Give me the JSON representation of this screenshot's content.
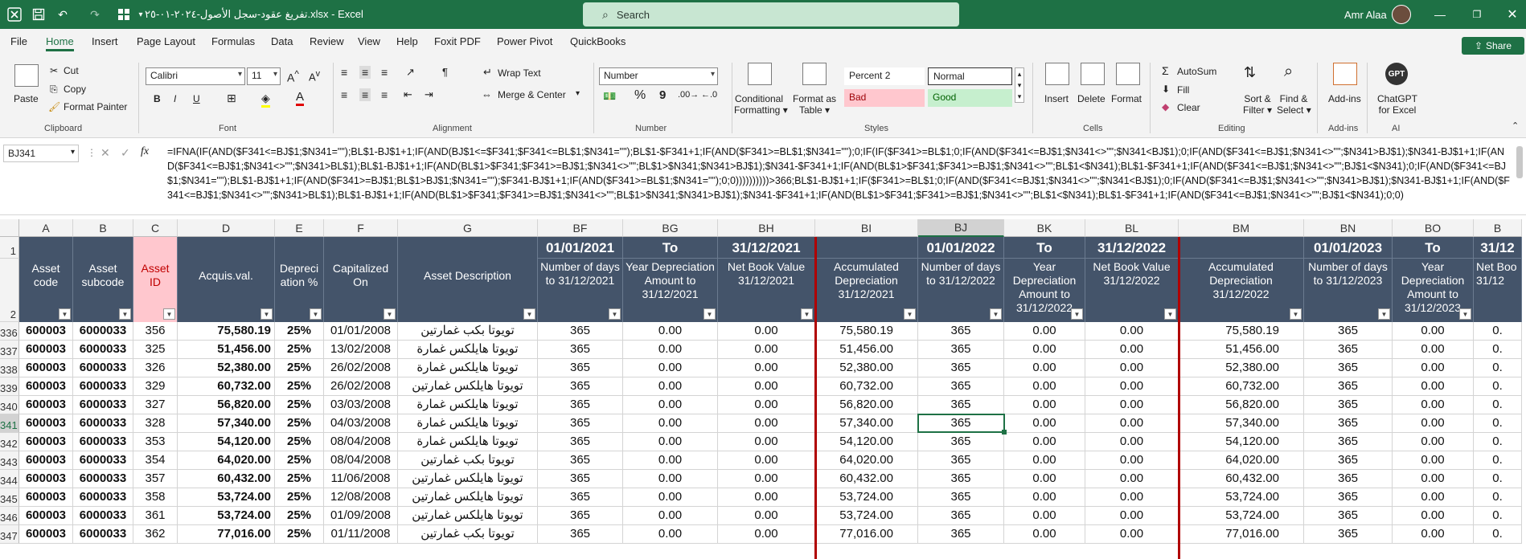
{
  "app": {
    "window_title": "تفريغ عقود-سجل الأصول-٢٠٢٤-٠١-٢٥.xlsx - Excel",
    "search_placeholder": "Search",
    "user_name": "Amr Alaa"
  },
  "menu": [
    "File",
    "Home",
    "Insert",
    "Page Layout",
    "Formulas",
    "Data",
    "Review",
    "View",
    "Help",
    "Foxit PDF",
    "Power Pivot",
    "QuickBooks"
  ],
  "share_label": "Share",
  "ribbon": {
    "clipboard": {
      "paste": "Paste",
      "cut": "Cut",
      "copy": "Copy",
      "format_painter": "Format Painter",
      "label": "Clipboard"
    },
    "font": {
      "name": "Calibri",
      "size": "11",
      "label": "Font",
      "bold": "B",
      "italic": "I",
      "underline": "U"
    },
    "alignment": {
      "wrap_text": "Wrap Text",
      "merge_center": "Merge & Center",
      "label": "Alignment"
    },
    "number": {
      "format": "Number",
      "percent": "%",
      "comma": "9",
      "label": "Number"
    },
    "styles": {
      "conditional_line1": "Conditional",
      "conditional_line2": "Formatting",
      "format_table_line1": "Format as",
      "format_table_line2": "Table",
      "percent2": "Percent 2",
      "normal": "Normal",
      "bad": "Bad",
      "good": "Good",
      "label": "Styles",
      "colors": {
        "bad_bg": "#ffc7ce",
        "good_bg": "#c6efce"
      }
    },
    "cells": {
      "insert": "Insert",
      "delete": "Delete",
      "format": "Format",
      "label": "Cells"
    },
    "editing": {
      "autosum": "AutoSum",
      "fill": "Fill",
      "clear": "Clear",
      "sort_line1": "Sort &",
      "sort_line2": "Filter",
      "find_line1": "Find &",
      "find_line2": "Select",
      "label": "Editing"
    },
    "addins": {
      "addins": "Add-ins",
      "label": "Add-ins"
    },
    "ai": {
      "gpt_icon_text": "GPT",
      "chatgpt_line1": "ChatGPT",
      "chatgpt_line2": "for Excel",
      "label": "AI"
    }
  },
  "formula_bar": {
    "name_box": "BJ341",
    "fx": "fx",
    "formula": "=IFNA(IF(AND($F341<=BJ$1;$N341=\"\");BL$1-BJ$1+1;IF(AND(BJ$1<=$F341;$F341<=BL$1;$N341=\"\");BL$1-$F341+1;IF(AND($F341>=BL$1;$N341=\"\");0;IF(IF($F341>=BL$1;0;IF(AND($F341<=BJ$1;$N341<>\"\";$N341<BJ$1);0;IF(AND($F341<=BJ$1;$N341<>\"\";$N341>BJ$1);$N341-BJ$1+1;IF(AND($F341<=BJ$1;$N341<>\"\";$N341>BL$1);BL$1-BJ$1+1;IF(AND(BL$1>$F341;$F341>=BJ$1;$N341<>\"\";BL$1>$N341;$N341>BJ$1);$N341-$F341+1;IF(AND(BL$1>$F341;$F341>=BJ$1;$N341<>\"\";BL$1<$N341);BL$1-$F341+1;IF(AND($F341<=BJ$1;$N341<>\"\";BJ$1<$N341);0;IF(AND($F341<=BJ$1;$N341=\"\");BL$1-BJ$1+1;IF(AND($F341>=BJ$1;BL$1>BJ$1;$N341=\"\");$F341-BJ$1+1;IF(AND($F341>=BL$1;$N341=\"\");0;0))))))))))>366;BL$1-BJ$1+1;IF($F341>=BL$1;0;IF(AND($F341<=BJ$1;$N341<>\"\";$N341<BJ$1);0;IF(AND($F341<=BJ$1;$N341<>\"\";$N341>BJ$1);$N341-BJ$1+1;IF(AND($F341<=BJ$1;$N341<>\"\";$N341>BL$1);BL$1-BJ$1+1;IF(AND(BL$1>$F341;$F341>=BJ$1;$N341<>\"\";BL$1>$N341;$N341>BJ$1);$N341-$F341+1;IF(AND(BL$1>$F341;$F341>=BJ$1;$N341<>\"\";BL$1<$N341);BL$1-$F341+1;IF(AND($F341<=BJ$1;$N341<>\"\";BJ$1<$N341);0;0)"
  },
  "grid": {
    "columns": [
      "A",
      "B",
      "C",
      "D",
      "E",
      "F",
      "G",
      "BF",
      "BG",
      "BH",
      "BI",
      "BJ",
      "BK",
      "BL",
      "BM",
      "BN",
      "BO",
      "B"
    ],
    "header_row1": [
      "01/01/2021",
      "To",
      "31/12/2021",
      "",
      "01/01/2022",
      "To",
      "31/12/2022",
      "",
      "01/01/2023",
      "To",
      "31/12"
    ],
    "header_row2": [
      "Asset code",
      "Asset subcode",
      "Asset ID",
      "Acquis.val.",
      "Depreci ation %",
      "Capitalized On",
      "Asset Description",
      "Number of days to 31/12/2021",
      "Year Depreciation Amount to 31/12/2021",
      "Net Book Value 31/12/2021",
      "Accumulated Depreciation 31/12/2021",
      "Number of days to 31/12/2022",
      "Year Depreciation Amount to 31/12/2022",
      "Net Book Value 31/12/2022",
      "Accumulated Depreciation 31/12/2022",
      "Number of days to 31/12/2023",
      "Year Depreciation Amount to 31/12/2023",
      "Net Boo 31/12"
    ],
    "row_numbers": [
      "1",
      "2",
      "336",
      "337",
      "338",
      "339",
      "340",
      "341",
      "342",
      "343",
      "344",
      "345",
      "346",
      "347"
    ],
    "rows": [
      [
        "600003",
        "6000033",
        "356",
        "75,580.19",
        "25%",
        "01/01/2008",
        "تويوتا بكب غمارتين",
        "365",
        "0.00",
        "0.00",
        "75,580.19",
        "365",
        "0.00",
        "0.00",
        "75,580.19",
        "365",
        "0.00",
        "0."
      ],
      [
        "600003",
        "6000033",
        "325",
        "51,456.00",
        "25%",
        "13/02/2008",
        "تويوتا هايلكس غمارة",
        "365",
        "0.00",
        "0.00",
        "51,456.00",
        "365",
        "0.00",
        "0.00",
        "51,456.00",
        "365",
        "0.00",
        "0."
      ],
      [
        "600003",
        "6000033",
        "326",
        "52,380.00",
        "25%",
        "26/02/2008",
        "تويوتا هايلكس غمارة",
        "365",
        "0.00",
        "0.00",
        "52,380.00",
        "365",
        "0.00",
        "0.00",
        "52,380.00",
        "365",
        "0.00",
        "0."
      ],
      [
        "600003",
        "6000033",
        "329",
        "60,732.00",
        "25%",
        "26/02/2008",
        "تويوتا هايلكس غمارتين",
        "365",
        "0.00",
        "0.00",
        "60,732.00",
        "365",
        "0.00",
        "0.00",
        "60,732.00",
        "365",
        "0.00",
        "0."
      ],
      [
        "600003",
        "6000033",
        "327",
        "56,820.00",
        "25%",
        "03/03/2008",
        "تويوتا هايلكس غمارة",
        "365",
        "0.00",
        "0.00",
        "56,820.00",
        "365",
        "0.00",
        "0.00",
        "56,820.00",
        "365",
        "0.00",
        "0."
      ],
      [
        "600003",
        "6000033",
        "328",
        "57,340.00",
        "25%",
        "04/03/2008",
        "تويوتا هايلكس غمارة",
        "365",
        "0.00",
        "0.00",
        "57,340.00",
        "365",
        "0.00",
        "0.00",
        "57,340.00",
        "365",
        "0.00",
        "0."
      ],
      [
        "600003",
        "6000033",
        "353",
        "54,120.00",
        "25%",
        "08/04/2008",
        "تويوتا هايلكس غمارة",
        "365",
        "0.00",
        "0.00",
        "54,120.00",
        "365",
        "0.00",
        "0.00",
        "54,120.00",
        "365",
        "0.00",
        "0."
      ],
      [
        "600003",
        "6000033",
        "354",
        "64,020.00",
        "25%",
        "08/04/2008",
        "تويوتا بكب غمارتين",
        "365",
        "0.00",
        "0.00",
        "64,020.00",
        "365",
        "0.00",
        "0.00",
        "64,020.00",
        "365",
        "0.00",
        "0."
      ],
      [
        "600003",
        "6000033",
        "357",
        "60,432.00",
        "25%",
        "11/06/2008",
        "تويوتا هايلكس غمارتين",
        "365",
        "0.00",
        "0.00",
        "60,432.00",
        "365",
        "0.00",
        "0.00",
        "60,432.00",
        "365",
        "0.00",
        "0."
      ],
      [
        "600003",
        "6000033",
        "358",
        "53,724.00",
        "25%",
        "12/08/2008",
        "تويوتا هايلكس غمارتين",
        "365",
        "0.00",
        "0.00",
        "53,724.00",
        "365",
        "0.00",
        "0.00",
        "53,724.00",
        "365",
        "0.00",
        "0."
      ],
      [
        "600003",
        "6000033",
        "361",
        "53,724.00",
        "25%",
        "01/09/2008",
        "تويوتا هايلكس غمارتين",
        "365",
        "0.00",
        "0.00",
        "53,724.00",
        "365",
        "0.00",
        "0.00",
        "53,724.00",
        "365",
        "0.00",
        "0."
      ],
      [
        "600003",
        "6000033",
        "362",
        "77,016.00",
        "25%",
        "01/11/2008",
        "تويوتا بكب غمارتين",
        "365",
        "0.00",
        "0.00",
        "77,016.00",
        "365",
        "0.00",
        "0.00",
        "77,016.00",
        "365",
        "0.00",
        "0."
      ]
    ],
    "colors": {
      "header_bg": "#44546a",
      "asset_id_header_bg": "#ffc7ce",
      "accent": "#1e7145",
      "period_divider": "#b00000"
    }
  }
}
